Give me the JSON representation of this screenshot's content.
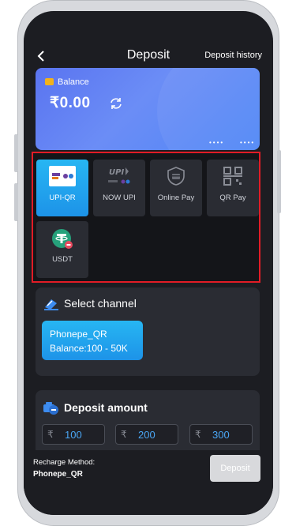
{
  "header": {
    "title": "Deposit",
    "history_label": "Deposit history"
  },
  "balance": {
    "label": "Balance",
    "amount": "₹0.00",
    "card_mask_1": "••••",
    "card_mask_2": "••••"
  },
  "payment_methods": [
    {
      "label": "UPI-QR",
      "icon": "upi-qr-logo-icon",
      "selected": true
    },
    {
      "label": "NOW UPI",
      "icon": "upi-logo-icon",
      "selected": false
    },
    {
      "label": "Online Pay",
      "icon": "online-pay-icon",
      "selected": false
    },
    {
      "label": "QR Pay",
      "icon": "qr-code-icon",
      "selected": false
    },
    {
      "label": "USDT",
      "icon": "tether-logo-icon",
      "selected": false
    }
  ],
  "channel": {
    "title": "Select channel",
    "options": [
      {
        "name": "Phonepe_QR",
        "range": "Balance:100 - 50K"
      }
    ]
  },
  "amount": {
    "title": "Deposit amount",
    "currency_symbol": "₹",
    "presets": [
      "100",
      "200",
      "300"
    ]
  },
  "footer": {
    "method_label": "Recharge Method:",
    "method_value": "Phonepe_QR",
    "deposit_label": "Deposit"
  },
  "colors": {
    "background": "#1c1d22",
    "panel": "#2a2c33",
    "accent": "#1d93e8",
    "card_gradient_start": "#5a74f0",
    "card_gradient_end": "#4e86f6",
    "highlight_border": "#e21c26",
    "deposit_disabled": "#d8d9dc"
  }
}
